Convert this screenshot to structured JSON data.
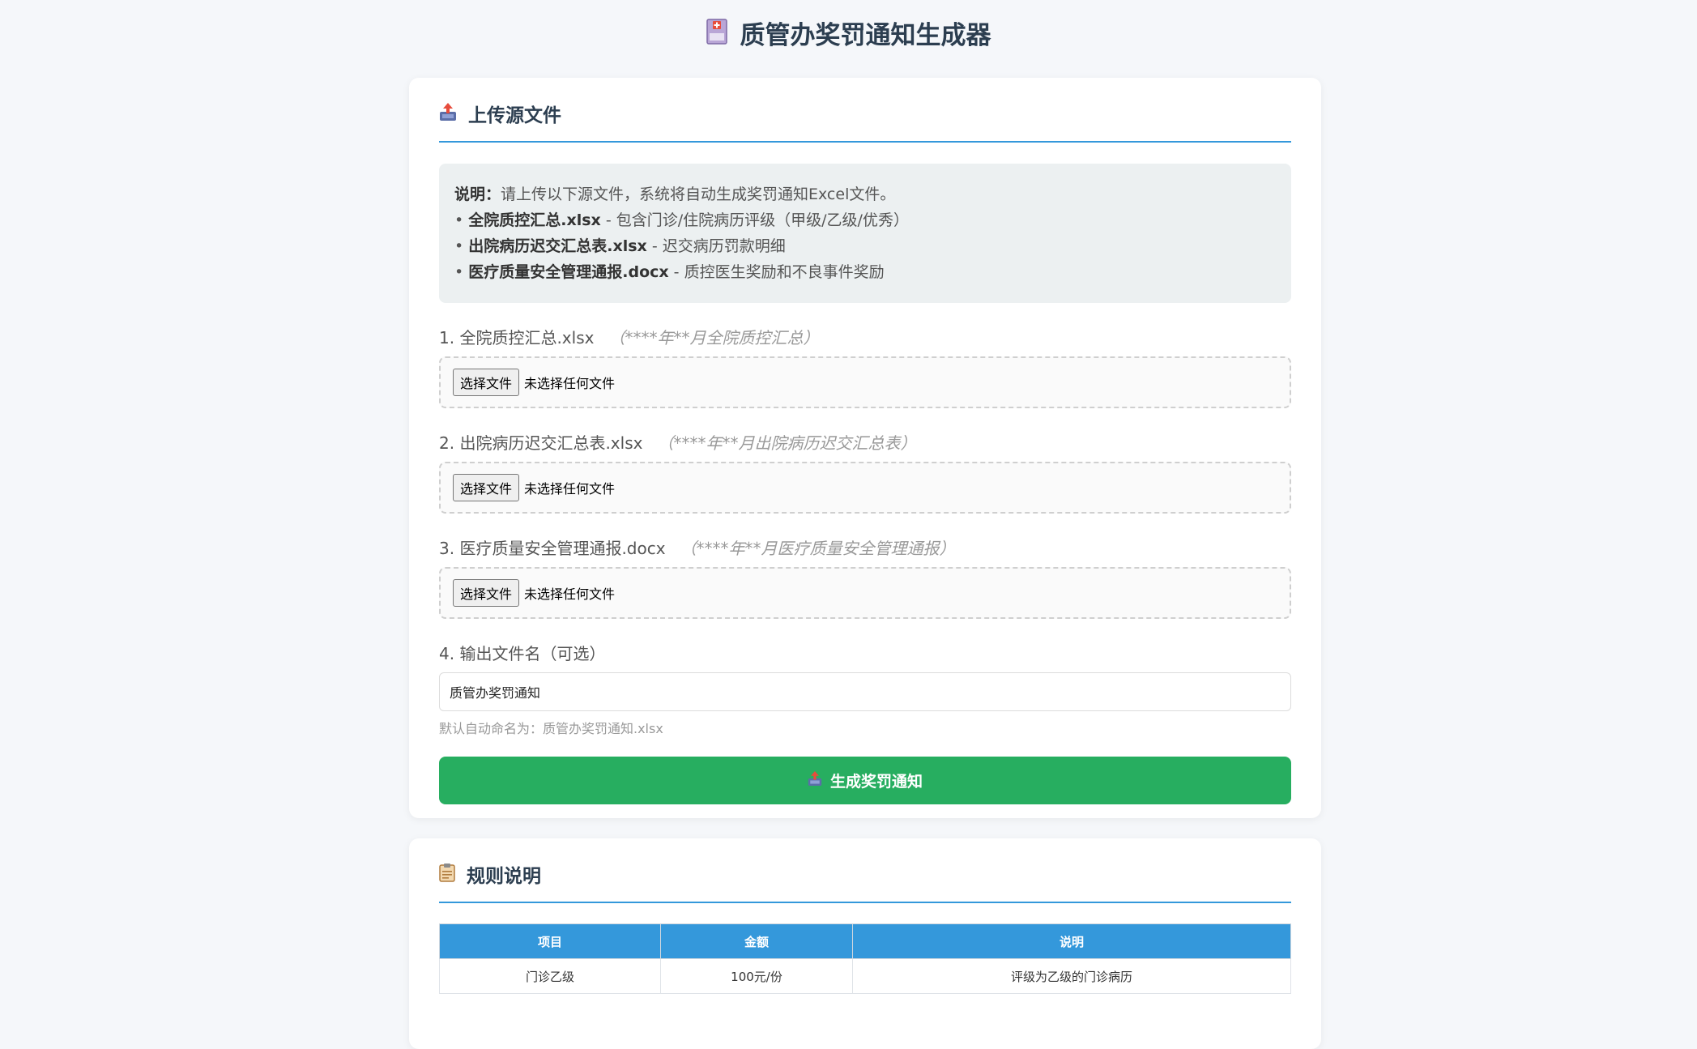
{
  "header": {
    "title": "质管办奖罚通知生成器",
    "icon": "medical-report-icon"
  },
  "upload": {
    "title": "上传源文件",
    "icon": "upload-tray-icon",
    "info": {
      "lead": "说明：",
      "text": "请上传以下源文件，系统将自动生成奖罚通知Excel文件。",
      "items": [
        {
          "name": "全院质控汇总.xlsx",
          "desc": " - 包含门诊/住院病历评级（甲级/乙级/优秀）"
        },
        {
          "name": "出院病历迟交汇总表.xlsx",
          "desc": " - 迟交病历罚款明细"
        },
        {
          "name": "医疗质量安全管理通报.docx",
          "desc": " - 质控医生奖励和不良事件奖励"
        }
      ]
    },
    "files": [
      {
        "label": "1. 全院质控汇总.xlsx",
        "hint": "（****年**月全院质控汇总）",
        "button": "选择文件",
        "status": "未选择任何文件"
      },
      {
        "label": "2. 出院病历迟交汇总表.xlsx",
        "hint": "（****年**月出院病历迟交汇总表）",
        "button": "选择文件",
        "status": "未选择任何文件"
      },
      {
        "label": "3. 医疗质量安全管理通报.docx",
        "hint": "（****年**月医疗质量安全管理通报）",
        "button": "选择文件",
        "status": "未选择任何文件"
      }
    ],
    "output": {
      "label": "4. 输出文件名（可选）",
      "value": "质管办奖罚通知",
      "help": "默认自动命名为：质管办奖罚通知.xlsx"
    },
    "generate_button": "生成奖罚通知"
  },
  "rules": {
    "title": "规则说明",
    "icon": "clipboard-icon",
    "columns": [
      "项目",
      "金额",
      "说明"
    ],
    "rows": [
      [
        "门诊乙级",
        "100元/份",
        "评级为乙级的门诊病历"
      ]
    ]
  },
  "colors": {
    "accent": "#3498db",
    "generate": "#27ae60",
    "background": "#f5f7fa"
  }
}
